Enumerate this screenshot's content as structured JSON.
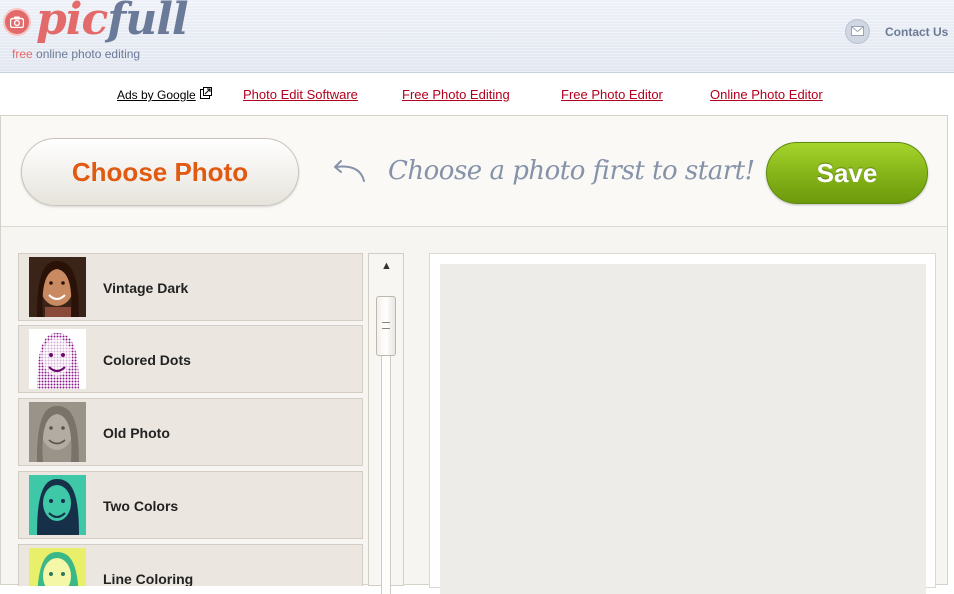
{
  "header": {
    "logo_pic": "pic",
    "logo_full": "full",
    "tagline_free": "free",
    "tagline_rest": " online photo editing",
    "contact_label": "Contact Us"
  },
  "ads": {
    "ads_by": "Ads by Google",
    "links": [
      "Photo Edit Software",
      "Free Photo Editing",
      "Free Photo Editor",
      "Online Photo Editor"
    ]
  },
  "toolbar": {
    "choose_label": "Choose Photo",
    "hint": "Choose a photo first to start!",
    "save_label": "Save"
  },
  "filters": [
    {
      "label": "Vintage Dark",
      "thumb": "vintage-dark"
    },
    {
      "label": "Colored Dots",
      "thumb": "colored-dots"
    },
    {
      "label": "Old Photo",
      "thumb": "old-photo"
    },
    {
      "label": "Two Colors",
      "thumb": "two-colors"
    },
    {
      "label": "Line Coloring",
      "thumb": "line-coloring"
    }
  ],
  "scrollbar": {
    "up_arrow": "▲"
  },
  "colors": {
    "brand_red": "#e36a6a",
    "brand_slate": "#6a7a98",
    "choose_orange": "#e05a12",
    "save_green": "#86b51a",
    "ad_link": "#b3001e"
  }
}
